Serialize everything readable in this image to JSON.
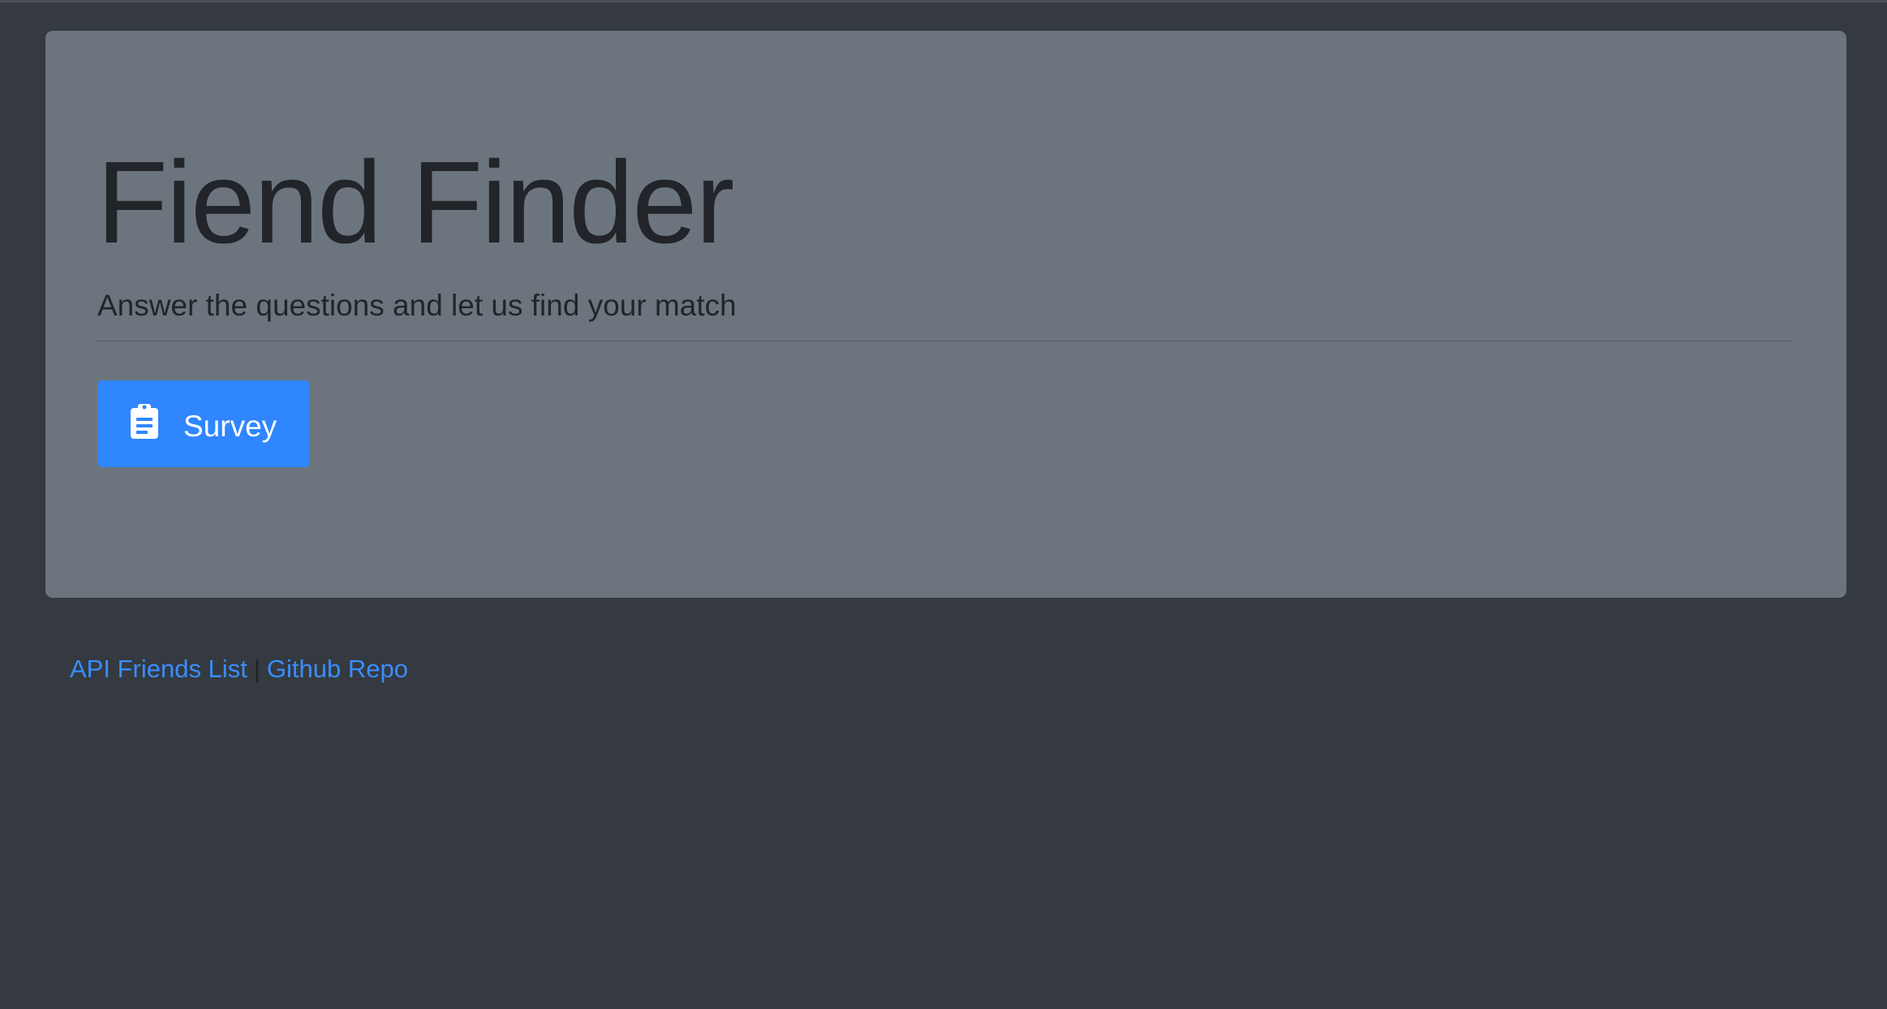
{
  "jumbotron": {
    "title": "Fiend Finder",
    "lead": "Answer the questions and let us find your match",
    "survey_button": {
      "icon": "clipboard-icon",
      "label": "Survey",
      "color": "#2f86ff"
    }
  },
  "footer": {
    "links": [
      {
        "label": "API Friends List"
      },
      {
        "label": "Github Repo"
      }
    ],
    "separator": "|",
    "link_color": "#3b8dff"
  },
  "colors": {
    "page_background": "#343a40",
    "jumbotron_background": "#6c757d",
    "text": "#212529"
  }
}
